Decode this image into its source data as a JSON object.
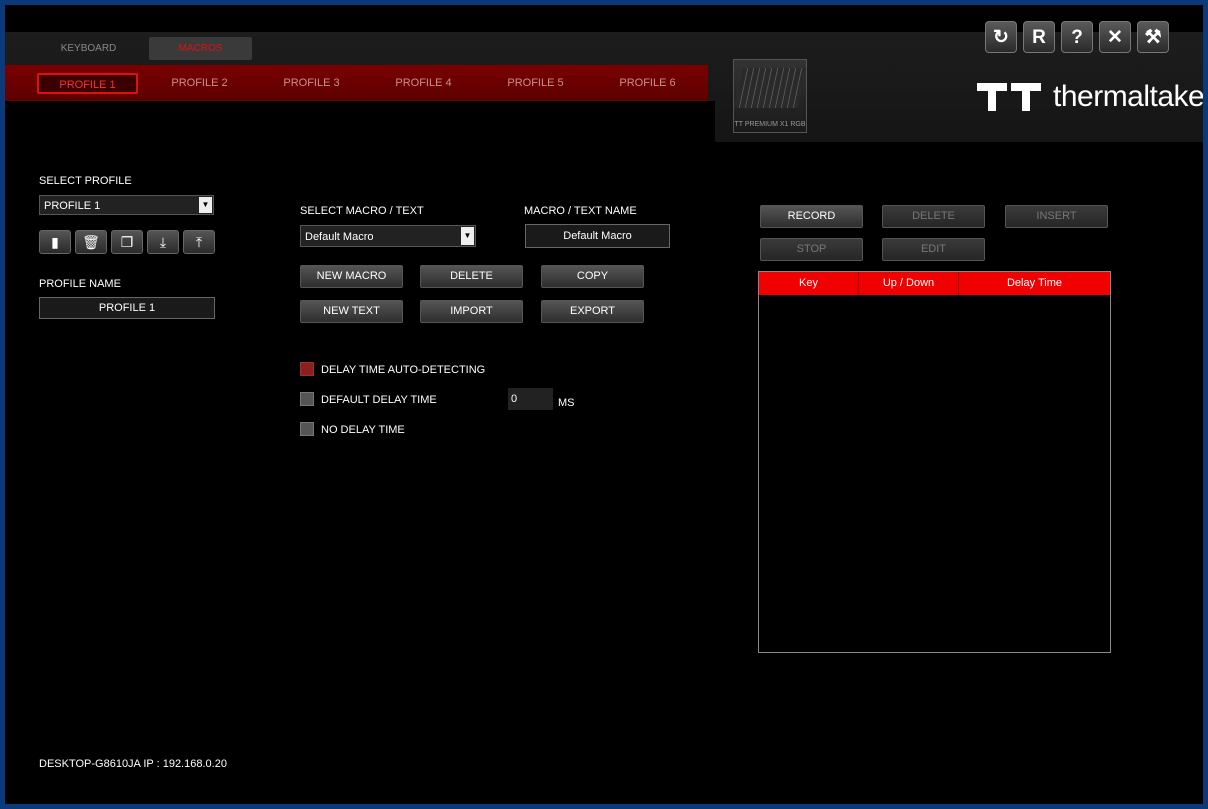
{
  "header": {
    "top_tabs": [
      "KEYBOARD",
      "MACROS"
    ],
    "profile_tabs": [
      "PROFILE 1",
      "PROFILE 2",
      "PROFILE 3",
      "PROFILE 4",
      "PROFILE 5",
      "PROFILE 6"
    ],
    "device_label": "TT PREMIUM X1 RGB",
    "brand_name": "thermaltake",
    "window_buttons": [
      {
        "icon": "refresh-icon",
        "glyph": "↻"
      },
      {
        "icon": "reset-icon",
        "glyph": "R"
      },
      {
        "icon": "help-icon",
        "glyph": "?"
      },
      {
        "icon": "close-icon",
        "glyph": "✕"
      },
      {
        "icon": "settings-tools-icon",
        "glyph": "⚒"
      }
    ]
  },
  "left": {
    "select_profile_label": "SELECT PROFILE",
    "select_profile_value": "PROFILE 1",
    "profile_actions": [
      {
        "icon": "save-icon",
        "glyph": "▮"
      },
      {
        "icon": "trash-icon",
        "glyph": "🗑"
      },
      {
        "icon": "copy-icon",
        "glyph": "❐"
      },
      {
        "icon": "import-download-icon",
        "glyph": "⤓"
      },
      {
        "icon": "export-upload-icon",
        "glyph": "⤒"
      }
    ],
    "profile_name_label": "PROFILE NAME",
    "profile_name_value": "PROFILE 1"
  },
  "macro": {
    "select_label": "SELECT MACRO / TEXT",
    "select_value": "Default Macro",
    "name_label": "MACRO / TEXT NAME",
    "name_value": "Default Macro",
    "buttons": {
      "new_macro": "NEW MACRO",
      "delete": "DELETE",
      "copy": "COPY",
      "new_text": "NEW TEXT",
      "import": "IMPORT",
      "export": "EXPORT"
    },
    "options": {
      "auto_detect": "DELAY TIME AUTO-DETECTING",
      "default_delay": "DEFAULT DELAY TIME",
      "no_delay": "NO DELAY TIME",
      "delay_value": "0",
      "delay_unit": "MS"
    }
  },
  "recorder": {
    "buttons": {
      "record": "RECORD",
      "delete": "DELETE",
      "insert": "INSERT",
      "stop": "STOP",
      "edit": "EDIT"
    },
    "columns": [
      "Key",
      "Up / Down",
      "Delay Time"
    ],
    "rows": []
  },
  "status": "DESKTOP-G8610JA IP : 192.168.0.20",
  "colors": {
    "accent": "#f00000",
    "background": "#000000",
    "window_frame": "#0a3a7a"
  }
}
